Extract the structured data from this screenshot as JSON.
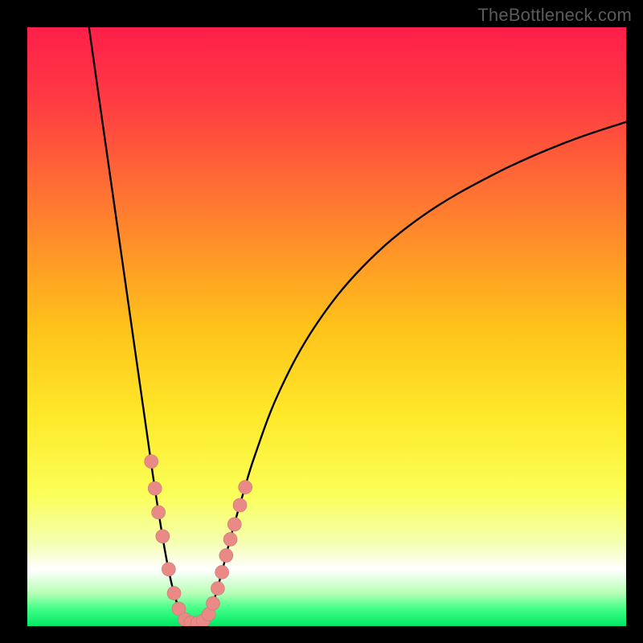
{
  "watermark": "TheBottleneck.com",
  "colors": {
    "frame": "#000000",
    "gradient_stops": [
      {
        "offset": 0.0,
        "color": "#ff1f4a"
      },
      {
        "offset": 0.12,
        "color": "#ff3a43"
      },
      {
        "offset": 0.3,
        "color": "#ff7a30"
      },
      {
        "offset": 0.5,
        "color": "#ffc21a"
      },
      {
        "offset": 0.65,
        "color": "#ffe92a"
      },
      {
        "offset": 0.78,
        "color": "#fbff58"
      },
      {
        "offset": 0.86,
        "color": "#f5ffb0"
      },
      {
        "offset": 0.905,
        "color": "#ffffff"
      },
      {
        "offset": 0.945,
        "color": "#b7ffb7"
      },
      {
        "offset": 0.97,
        "color": "#46ff88"
      },
      {
        "offset": 1.0,
        "color": "#00e865"
      }
    ],
    "curve": "#000000",
    "marker_fill": "#e98a86",
    "marker_stroke": "#c97874"
  },
  "chart_data": {
    "type": "line",
    "title": "",
    "xlabel": "",
    "ylabel": "",
    "xlim": [
      0,
      100
    ],
    "ylim": [
      0,
      100
    ],
    "series": [
      {
        "name": "bottleneck-curve-left",
        "x": [
          10.3,
          12,
          14,
          16,
          18,
          20,
          21,
          22,
          23,
          24,
          25,
          26
        ],
        "y": [
          100,
          88,
          74,
          60,
          46,
          32,
          25,
          18.5,
          12.5,
          7.5,
          3.8,
          1.2
        ]
      },
      {
        "name": "bottleneck-curve-floor",
        "x": [
          26,
          27,
          28,
          29,
          30
        ],
        "y": [
          1.2,
          0.6,
          0.4,
          0.6,
          1.2
        ]
      },
      {
        "name": "bottleneck-curve-right",
        "x": [
          30,
          31,
          32,
          33,
          34,
          36,
          38,
          42,
          48,
          56,
          66,
          78,
          90,
          100
        ],
        "y": [
          1.2,
          3.8,
          7.2,
          11,
          15,
          22,
          28.5,
          39,
          50,
          60,
          68.5,
          75.5,
          80.8,
          84.2
        ]
      }
    ],
    "markers": {
      "name": "highlighted-points",
      "points": [
        {
          "x": 20.7,
          "y": 27.5
        },
        {
          "x": 21.3,
          "y": 23.0
        },
        {
          "x": 21.9,
          "y": 19.0
        },
        {
          "x": 22.6,
          "y": 15.0
        },
        {
          "x": 23.6,
          "y": 9.5
        },
        {
          "x": 24.5,
          "y": 5.5
        },
        {
          "x": 25.3,
          "y": 2.9
        },
        {
          "x": 26.3,
          "y": 1.1
        },
        {
          "x": 27.3,
          "y": 0.55
        },
        {
          "x": 28.4,
          "y": 0.5
        },
        {
          "x": 29.4,
          "y": 0.9
        },
        {
          "x": 30.3,
          "y": 2.0
        },
        {
          "x": 31.0,
          "y": 3.8
        },
        {
          "x": 31.8,
          "y": 6.3
        },
        {
          "x": 32.5,
          "y": 9.0
        },
        {
          "x": 33.2,
          "y": 11.8
        },
        {
          "x": 33.9,
          "y": 14.5
        },
        {
          "x": 34.6,
          "y": 17.0
        },
        {
          "x": 35.5,
          "y": 20.2
        },
        {
          "x": 36.4,
          "y": 23.2
        }
      ]
    }
  }
}
